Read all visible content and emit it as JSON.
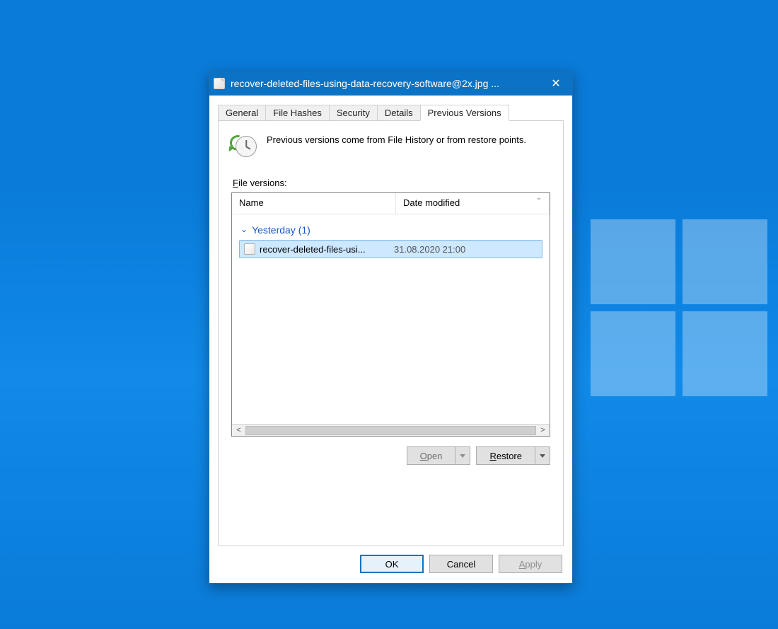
{
  "titlebar": {
    "title": "recover-deleted-files-using-data-recovery-software@2x.jpg ...",
    "close_icon": "✕"
  },
  "tabs": {
    "items": [
      {
        "label": "General"
      },
      {
        "label": "File Hashes"
      },
      {
        "label": "Security"
      },
      {
        "label": "Details"
      },
      {
        "label": "Previous Versions"
      }
    ],
    "active_index": 4
  },
  "intro_text": "Previous versions come from File History or from restore points.",
  "section_label_prefix": "F",
  "section_label_rest": "ile versions:",
  "columns": {
    "name": "Name",
    "date": "Date modified"
  },
  "group": {
    "label": "Yesterday (1)"
  },
  "rows": [
    {
      "filename": "recover-deleted-files-usi...",
      "date": "31.08.2020 21:00",
      "selected": true
    }
  ],
  "actions": {
    "open_prefix": "O",
    "open_rest": "pen",
    "restore_prefix": "R",
    "restore_rest": "estore"
  },
  "footer": {
    "ok": "OK",
    "cancel": "Cancel",
    "apply_prefix": "A",
    "apply_rest": "pply"
  },
  "colors": {
    "accent": "#0a73c6",
    "selection": "#cde8ff",
    "link_blue": "#1a56c4",
    "green": "#51a43a"
  }
}
